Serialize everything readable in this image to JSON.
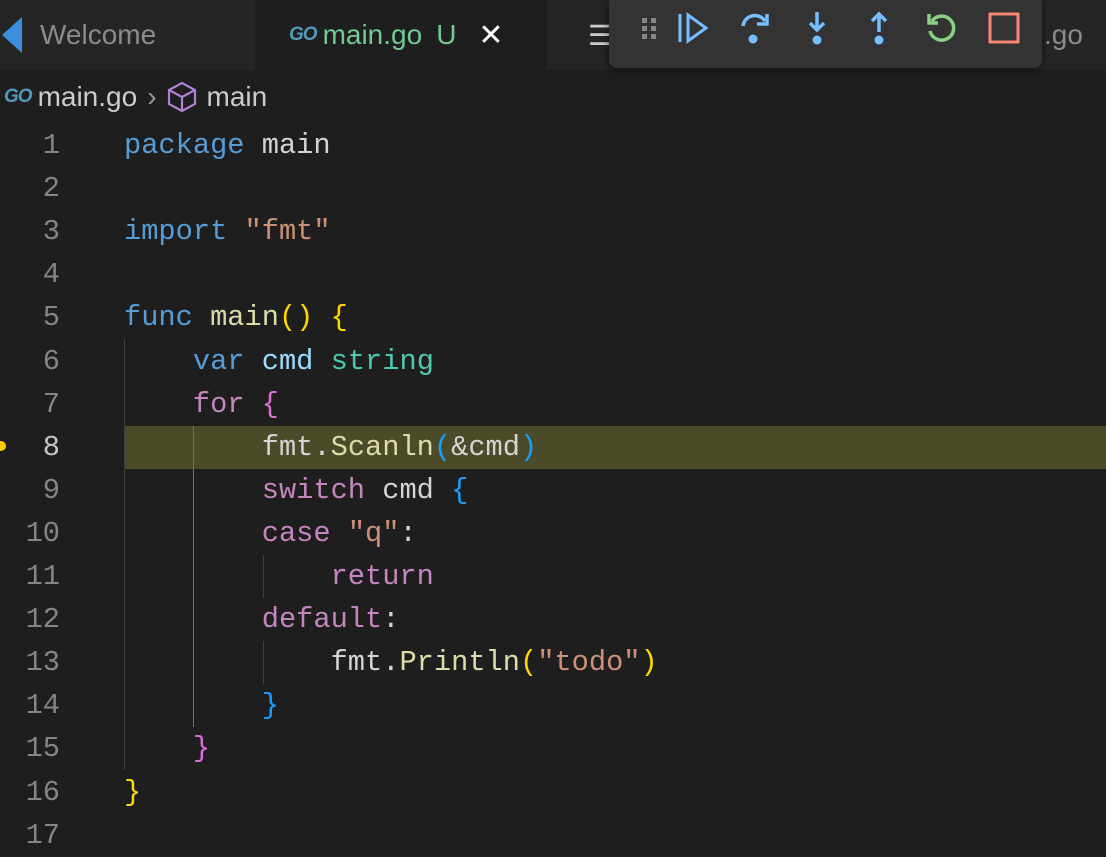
{
  "tabs": [
    {
      "label": "Welcome"
    },
    {
      "icon_text": "GO",
      "label": "main.go",
      "status": "U"
    },
    {
      "label": ".go"
    }
  ],
  "breadcrumb": {
    "icon_text": "GO",
    "file": "main.go",
    "symbol": "main"
  },
  "debug_toolbar": [
    "drag-handle",
    "continue",
    "step-over",
    "step-into",
    "step-out",
    "restart",
    "stop"
  ],
  "colors": {
    "current_line": "#4b4b2a",
    "continue": "#75beff",
    "restart": "#89d185",
    "stop": "#f48771"
  },
  "editor": {
    "current_line": 8,
    "lines": [
      [
        [
          "package",
          "kw"
        ],
        [
          " main",
          "p"
        ]
      ],
      [],
      [
        [
          "import",
          "kw"
        ],
        [
          " ",
          "p"
        ],
        [
          "\"fmt\"",
          "str"
        ]
      ],
      [],
      [
        [
          "func",
          "kw"
        ],
        [
          " ",
          "p"
        ],
        [
          "main",
          "fn"
        ],
        [
          "()",
          "b1"
        ],
        [
          " ",
          "p"
        ],
        [
          "{",
          "b1"
        ]
      ],
      [
        [
          "    ",
          "p"
        ],
        [
          "var",
          "kw"
        ],
        [
          " ",
          "p"
        ],
        [
          "cmd",
          "var"
        ],
        [
          " ",
          "p"
        ],
        [
          "string",
          "type"
        ]
      ],
      [
        [
          "    ",
          "p"
        ],
        [
          "for",
          "ctl"
        ],
        [
          " ",
          "p"
        ],
        [
          "{",
          "b2"
        ]
      ],
      [
        [
          "        ",
          "p"
        ],
        [
          "fmt",
          "p"
        ],
        [
          ".",
          "p"
        ],
        [
          "Scanln",
          "fn"
        ],
        [
          "(",
          "b3"
        ],
        [
          "&cmd",
          "p"
        ],
        [
          ")",
          "b3"
        ]
      ],
      [
        [
          "        ",
          "p"
        ],
        [
          "switch",
          "ctl"
        ],
        [
          " cmd ",
          "p"
        ],
        [
          "{",
          "b3"
        ]
      ],
      [
        [
          "        ",
          "p"
        ],
        [
          "case",
          "ctl"
        ],
        [
          " ",
          "p"
        ],
        [
          "\"q\"",
          "str"
        ],
        [
          ":",
          "p"
        ]
      ],
      [
        [
          "            ",
          "p"
        ],
        [
          "return",
          "ctl"
        ]
      ],
      [
        [
          "        ",
          "p"
        ],
        [
          "default",
          "ctl"
        ],
        [
          ":",
          "p"
        ]
      ],
      [
        [
          "            ",
          "p"
        ],
        [
          "fmt",
          "p"
        ],
        [
          ".",
          "p"
        ],
        [
          "Println",
          "fn"
        ],
        [
          "(",
          "b1"
        ],
        [
          "\"todo\"",
          "str"
        ],
        [
          ")",
          "b1"
        ]
      ],
      [
        [
          "        ",
          "p"
        ],
        [
          "}",
          "b3"
        ]
      ],
      [
        [
          "    ",
          "p"
        ],
        [
          "}",
          "b2"
        ]
      ],
      [
        [
          "}",
          "b1"
        ]
      ],
      []
    ]
  }
}
